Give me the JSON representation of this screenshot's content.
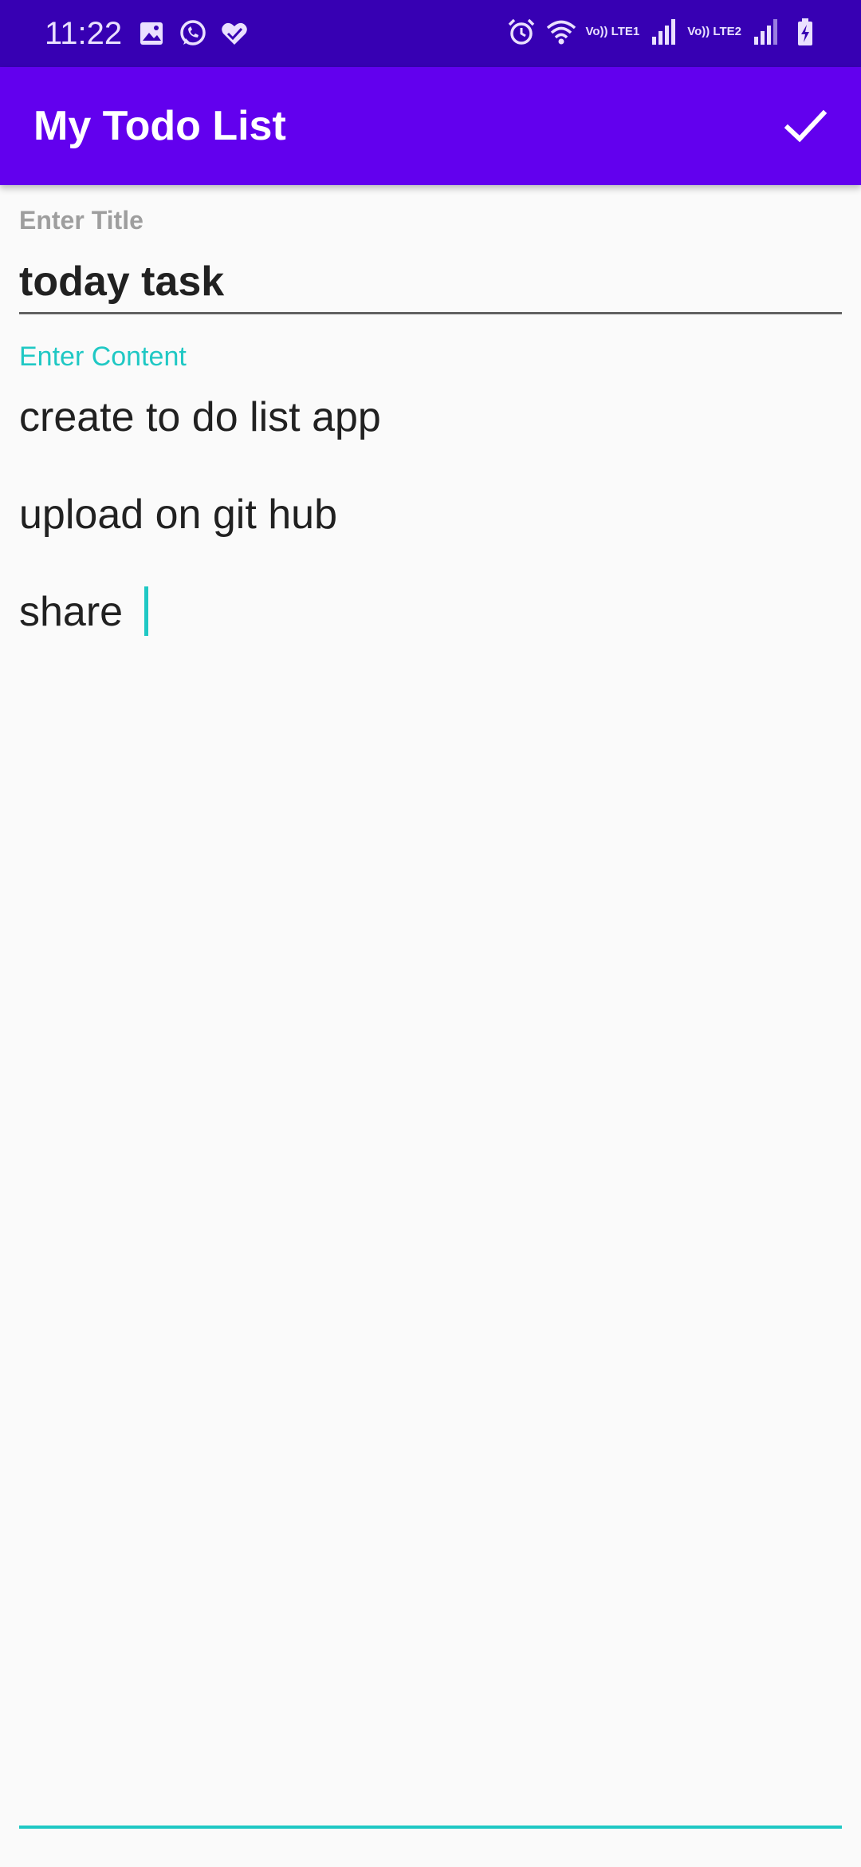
{
  "status_bar": {
    "time": "11:22",
    "left_icons": [
      "image-icon",
      "whatsapp-icon",
      "health-icon"
    ],
    "right_icons": [
      "alarm-icon",
      "wifi-icon",
      "signal-lte1-icon",
      "signal-lte2-icon",
      "battery-charging-icon"
    ],
    "sim1_label": "Vo)) LTE1",
    "sim2_label": "Vo)) LTE2"
  },
  "app_bar": {
    "title": "My Todo List",
    "action_icon": "check-icon"
  },
  "form": {
    "title_label": "Enter Title",
    "title_value": "today task",
    "content_label": "Enter Content",
    "content_lines": [
      "create to do list app",
      "upload on git hub",
      "share "
    ]
  },
  "colors": {
    "status_bar": "#3700b3",
    "app_bar": "#6200ee",
    "accent": "#1fc8c4",
    "background": "#fafafa"
  }
}
